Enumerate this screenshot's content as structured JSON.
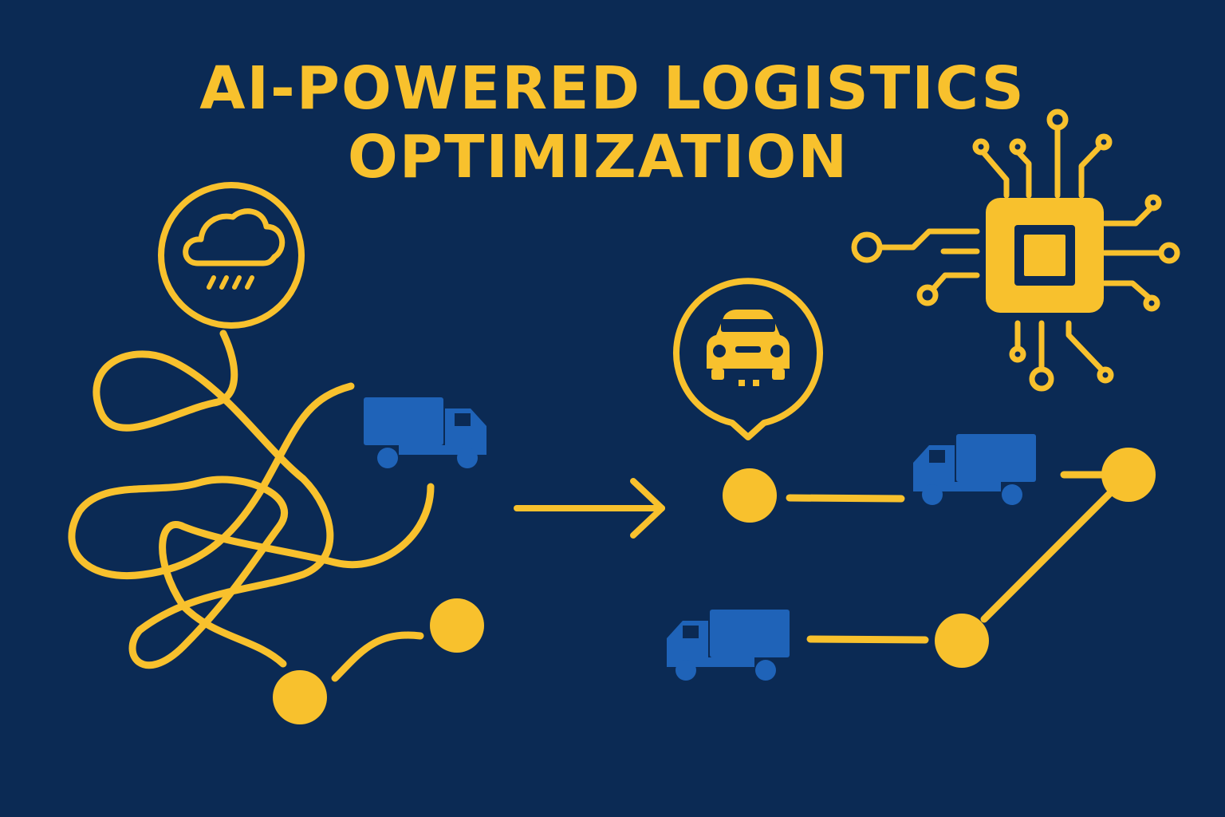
{
  "title": {
    "line1": "AI-POWERED LOGISTICS",
    "line2": "OPTIMIZATION"
  },
  "colors": {
    "background": "#0b2a54",
    "accent_yellow": "#f8c12d",
    "truck_blue": "#1f63b8"
  },
  "icons": [
    "rain-cloud-icon",
    "car-icon",
    "ai-chip-icon",
    "truck-icon",
    "arrow-right-icon"
  ]
}
